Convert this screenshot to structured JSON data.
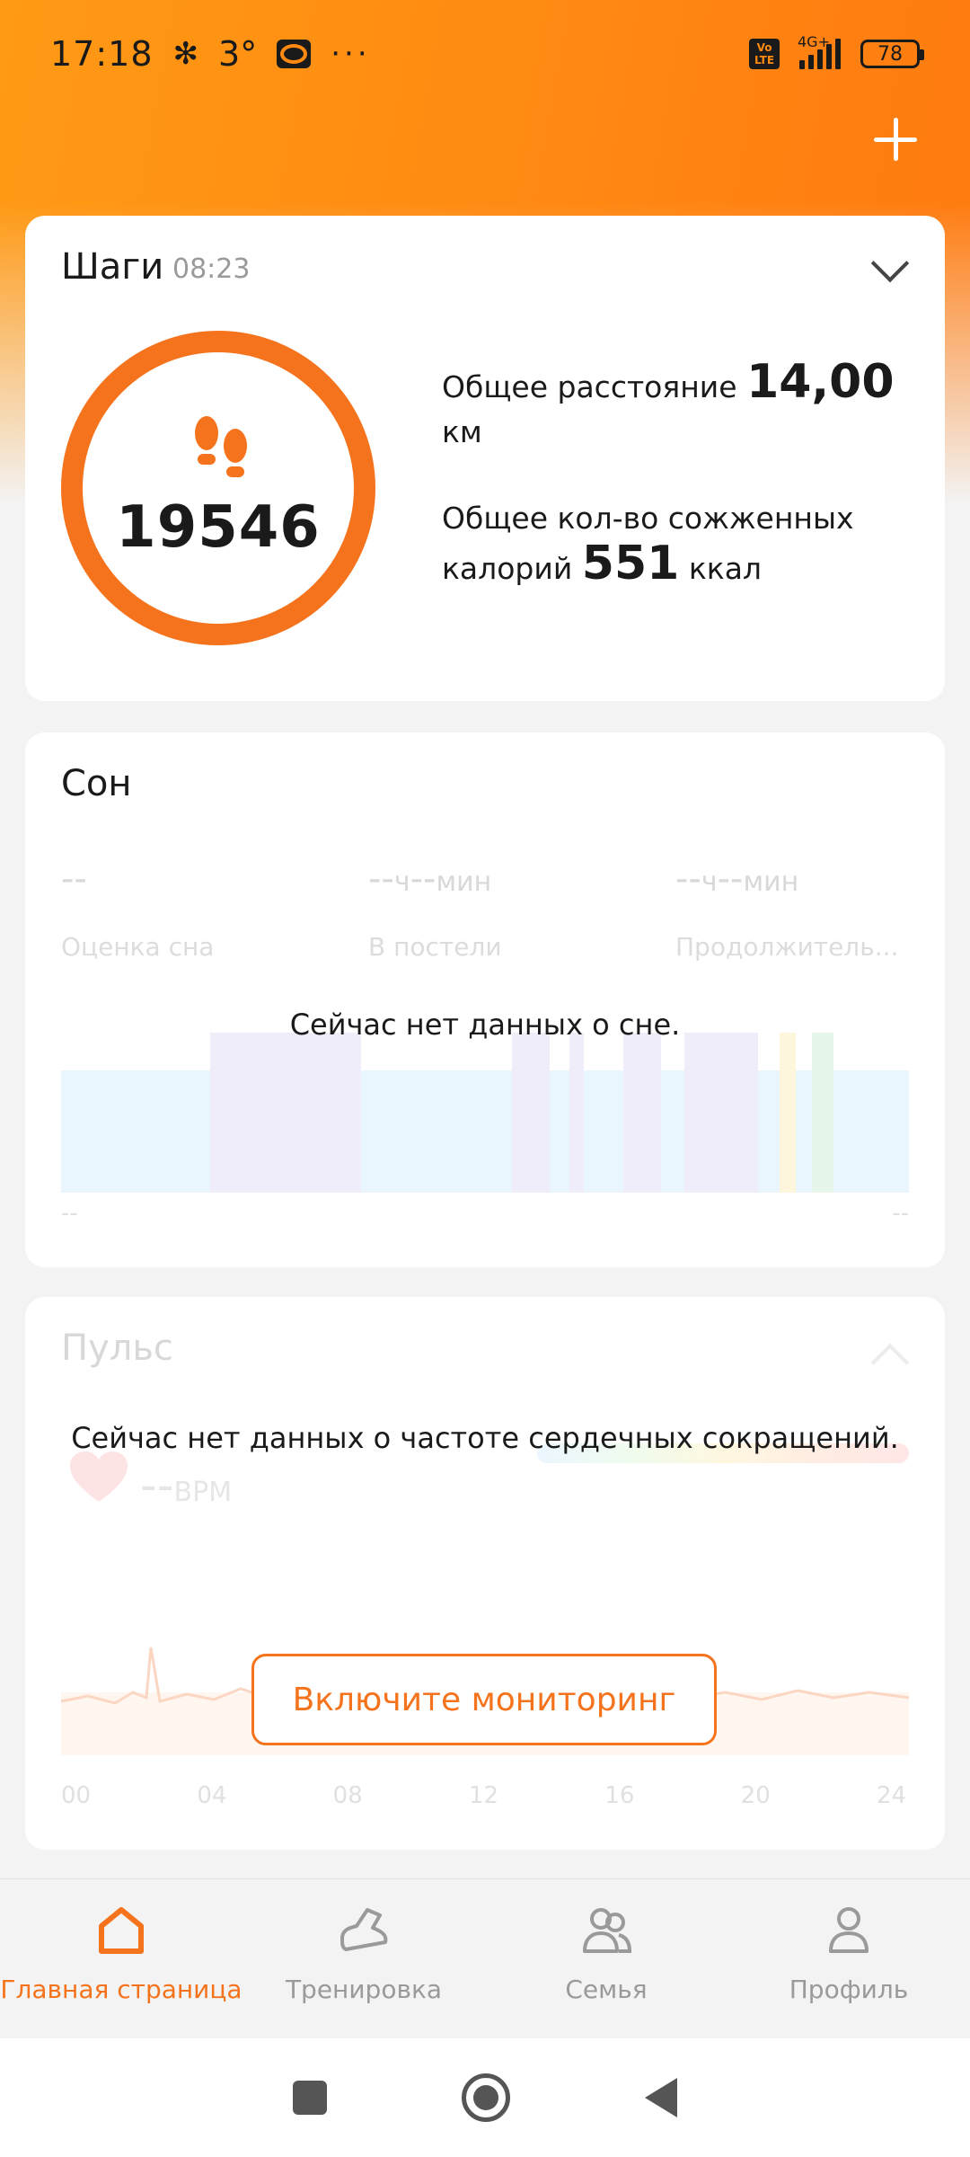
{
  "status_bar": {
    "time": "17:18",
    "temperature": "3°",
    "more": "···",
    "network": "4G+",
    "volte": "Vo LTE",
    "battery": "78"
  },
  "steps": {
    "title": "Шаги",
    "time": "08:23",
    "count": "19546",
    "distance_label": "Общее расстояние",
    "distance_value": "14,00",
    "distance_unit": "км",
    "calories_label": "Общее кол-во сожженных калорий",
    "calories_value": "551",
    "calories_unit": "ккал"
  },
  "sleep": {
    "title": "Сон",
    "score_value": "--",
    "score_label": "Оценка сна",
    "in_bed_hours": "--",
    "in_bed_h_unit": "ч",
    "in_bed_minutes": "--",
    "in_bed_min_unit": "мин",
    "in_bed_label": "В постели",
    "duration_hours": "--",
    "duration_h_unit": "ч",
    "duration_minutes": "--",
    "duration_min_unit": "мин",
    "duration_label": "Продолжитель...",
    "empty_message": "Сейчас нет данных о сне.",
    "axis_start": "--",
    "axis_end": "--"
  },
  "pulse": {
    "title": "Пульс",
    "empty_message": "Сейчас нет данных о частоте сердечных сокращений.",
    "bpm_value": "--",
    "bpm_unit": "BPM",
    "enable_button": "Включите мониторинг",
    "hours": [
      "00",
      "04",
      "08",
      "12",
      "16",
      "20",
      "24"
    ]
  },
  "bottom_nav": {
    "items": [
      {
        "label": "Главная страница",
        "icon": "home-icon",
        "active": true
      },
      {
        "label": "Тренировка",
        "icon": "sneaker-icon",
        "active": false
      },
      {
        "label": "Семья",
        "icon": "family-icon",
        "active": false
      },
      {
        "label": "Профиль",
        "icon": "profile-icon",
        "active": false
      }
    ]
  },
  "colors": {
    "accent": "#f5731c",
    "header_orange": "#ff8a12"
  }
}
